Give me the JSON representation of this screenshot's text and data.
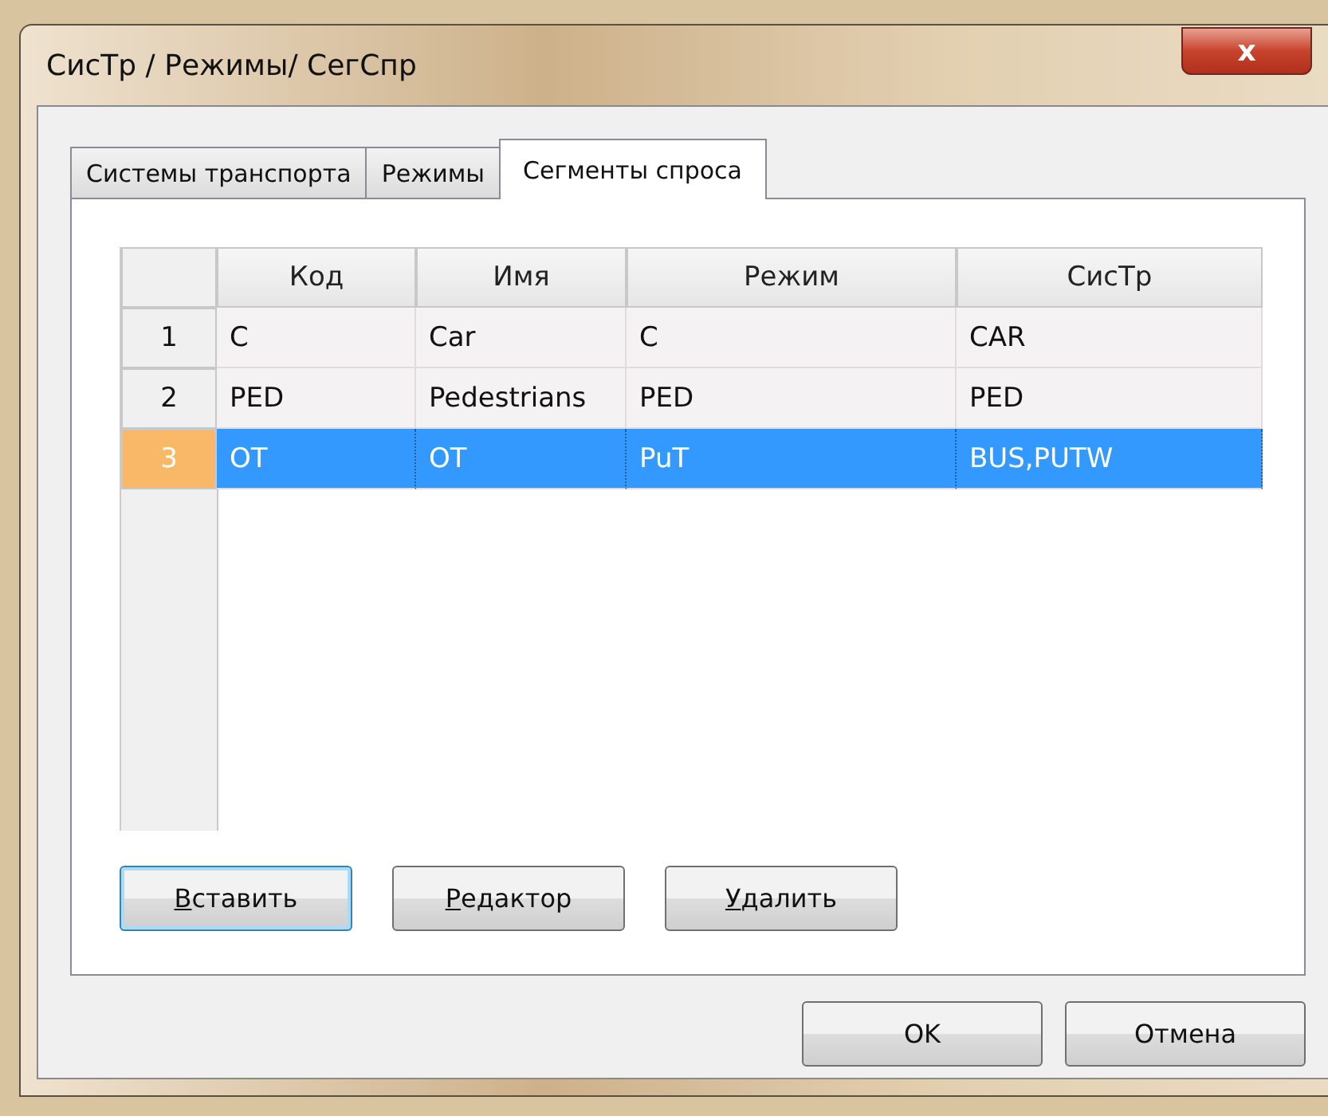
{
  "window": {
    "title": "СисТр / Режимы/ СегСпр",
    "close_label": "x"
  },
  "tabs": [
    {
      "label": "Системы транспорта",
      "selected": false
    },
    {
      "label": "Режимы",
      "selected": false
    },
    {
      "label": "Сегменты спроса",
      "selected": true
    }
  ],
  "table": {
    "columns": [
      "Код",
      "Имя",
      "Режим",
      "СисТр"
    ],
    "rows": [
      {
        "number": "1",
        "cells": [
          "C",
          "Car",
          "C",
          "CAR"
        ],
        "selected": false
      },
      {
        "number": "2",
        "cells": [
          "PED",
          "Pedestrians",
          "PED",
          "PED"
        ],
        "selected": false
      },
      {
        "number": "3",
        "cells": [
          "OT",
          "OT",
          "PuT",
          "BUS,PUTW"
        ],
        "selected": true
      }
    ]
  },
  "actions": [
    {
      "accel": "В",
      "rest": "ставить",
      "focused": true
    },
    {
      "accel": "Р",
      "rest": "едактор",
      "focused": false
    },
    {
      "accel": "У",
      "rest": "далить",
      "focused": false
    }
  ],
  "buttons": [
    "OK",
    "Отмена"
  ]
}
